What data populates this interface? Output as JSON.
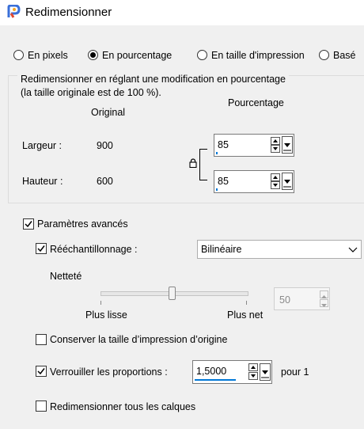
{
  "window": {
    "title": "Redimensionner"
  },
  "mode_radios": [
    {
      "label": "En pixels",
      "selected": false
    },
    {
      "label": "En pourcentage",
      "selected": true
    },
    {
      "label": "En taille d'impression",
      "selected": false
    },
    {
      "label": "Basé",
      "selected": false
    }
  ],
  "group": {
    "description_line1": "Redimensionner en réglant une modification en pourcentage",
    "description_line2": "(la taille originale est de 100 %).",
    "col_original": "Original",
    "col_percentage": "Pourcentage",
    "width_label": "Largeur :",
    "width_original": "900",
    "width_percent": "85",
    "height_label": "Hauteur :",
    "height_original": "600",
    "height_percent": "85"
  },
  "advanced": {
    "label": "Paramètres avancés",
    "checked": true,
    "resample_label": "Rééchantillonnage :",
    "resample_checked": true,
    "resample_value": "Bilinéaire",
    "sharpness_label": "Netteté",
    "sharpness_value": "50",
    "sharpness_level_percent": 50,
    "slider_left_label": "Plus lisse",
    "slider_right_label": "Plus net",
    "keep_print_size_label": "Conserver la taille d’impression d’origine",
    "keep_print_size_checked": false,
    "lock_ratio_label": "Verrouiller les proportions :",
    "lock_ratio_checked": true,
    "lock_ratio_value": "1,5000",
    "lock_ratio_suffix": "pour 1",
    "resize_all_layers_label": "Redimensionner tous les calques",
    "resize_all_layers_checked": false
  },
  "colors": {
    "accent": "#0078d7",
    "checkmark": "#000000"
  }
}
